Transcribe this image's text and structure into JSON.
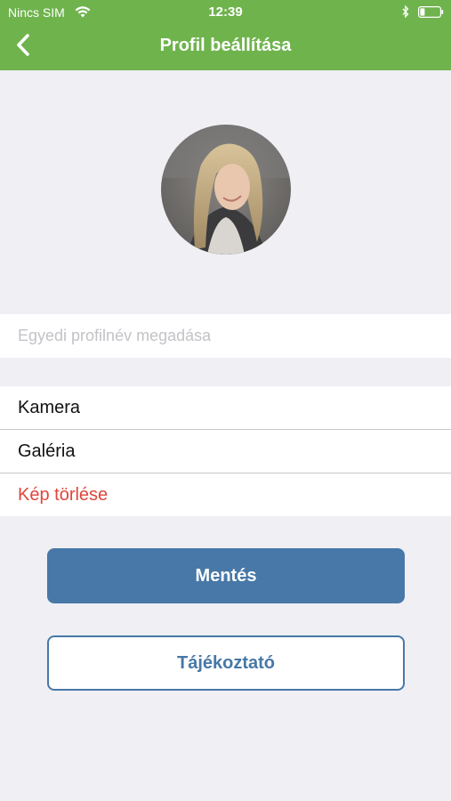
{
  "status_bar": {
    "carrier": "Nincs SIM",
    "time": "12:39",
    "icons": [
      "wifi-icon",
      "bluetooth-icon",
      "battery-icon"
    ]
  },
  "header": {
    "title": "Profil beállítása",
    "back_icon": "chevron-left-icon",
    "background_color": "#6fb34d"
  },
  "avatar": {
    "description": "profile-photo"
  },
  "profile_name": {
    "value": "",
    "placeholder": "Egyedi profilnév megadása"
  },
  "photo_options": [
    {
      "label": "Kamera"
    },
    {
      "label": "Galéria"
    },
    {
      "label": "Kép törlése",
      "color": "#e0453b"
    }
  ],
  "buttons": {
    "save_label": "Mentés",
    "info_label": "Tájékoztató",
    "accent_color": "#4778a7"
  }
}
